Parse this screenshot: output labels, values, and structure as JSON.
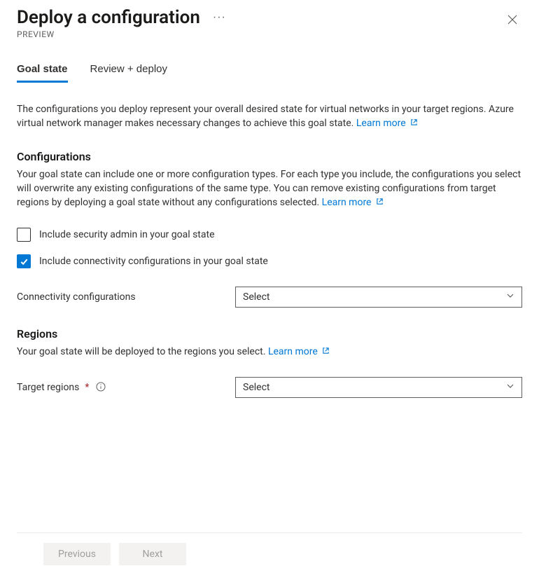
{
  "header": {
    "title": "Deploy a configuration",
    "subtitle": "PREVIEW"
  },
  "tabs": {
    "goal_state": "Goal state",
    "review_deploy": "Review + deploy"
  },
  "intro": {
    "text": "The configurations you deploy represent your overall desired state for virtual networks in your target regions. Azure virtual network manager makes necessary changes to achieve this goal state.",
    "learn_more": "Learn more"
  },
  "configurations": {
    "heading": "Configurations",
    "body": "Your goal state can include one or more configuration types. For each type you include, the configurations you select will overwrite any existing configurations of the same type. You can remove existing configurations from target regions by deploying a goal state without any configurations selected.",
    "learn_more": "Learn more",
    "chk_security": "Include security admin in your goal state",
    "chk_connectivity": "Include connectivity configurations in your goal state",
    "connectivity_label": "Connectivity configurations",
    "connectivity_placeholder": "Select"
  },
  "regions": {
    "heading": "Regions",
    "body": "Your goal state will be deployed to the regions you select.",
    "learn_more": "Learn more",
    "target_label": "Target regions",
    "target_placeholder": "Select"
  },
  "footer": {
    "previous": "Previous",
    "next": "Next"
  }
}
